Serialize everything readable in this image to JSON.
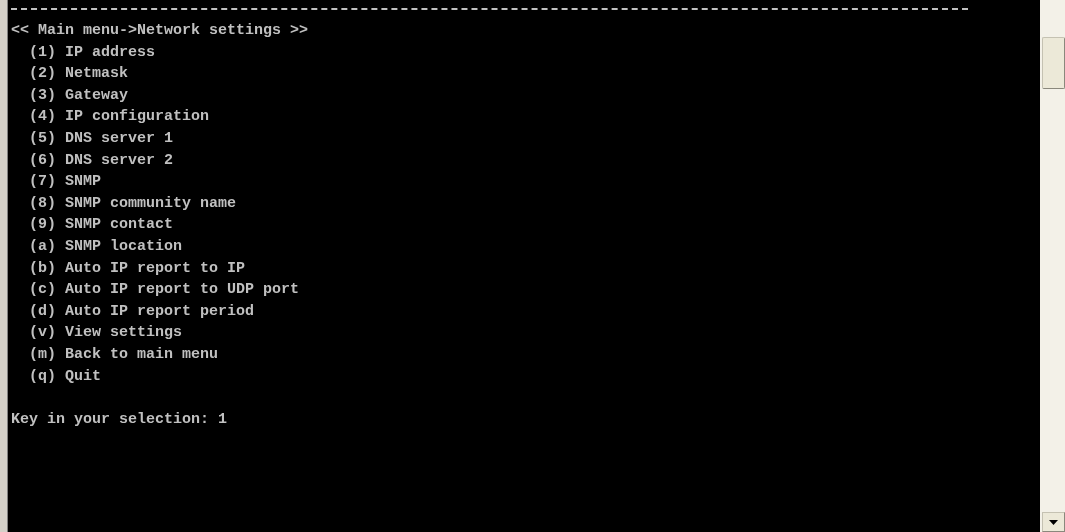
{
  "console": {
    "title": "<< Main menu->Network settings >>",
    "menu_items": [
      "(1) IP address",
      "(2) Netmask",
      "(3) Gateway",
      "(4) IP configuration",
      "(5) DNS server 1",
      "(6) DNS server 2",
      "(7) SNMP",
      "(8) SNMP community name",
      "(9) SNMP contact",
      "(a) SNMP location",
      "(b) Auto IP report to IP",
      "(c) Auto IP report to UDP port",
      "(d) Auto IP report period",
      "(v) View settings",
      "(m) Back to main menu",
      "(q) Quit"
    ],
    "prompt": {
      "label": "Key in your selection:",
      "value": "1"
    }
  }
}
